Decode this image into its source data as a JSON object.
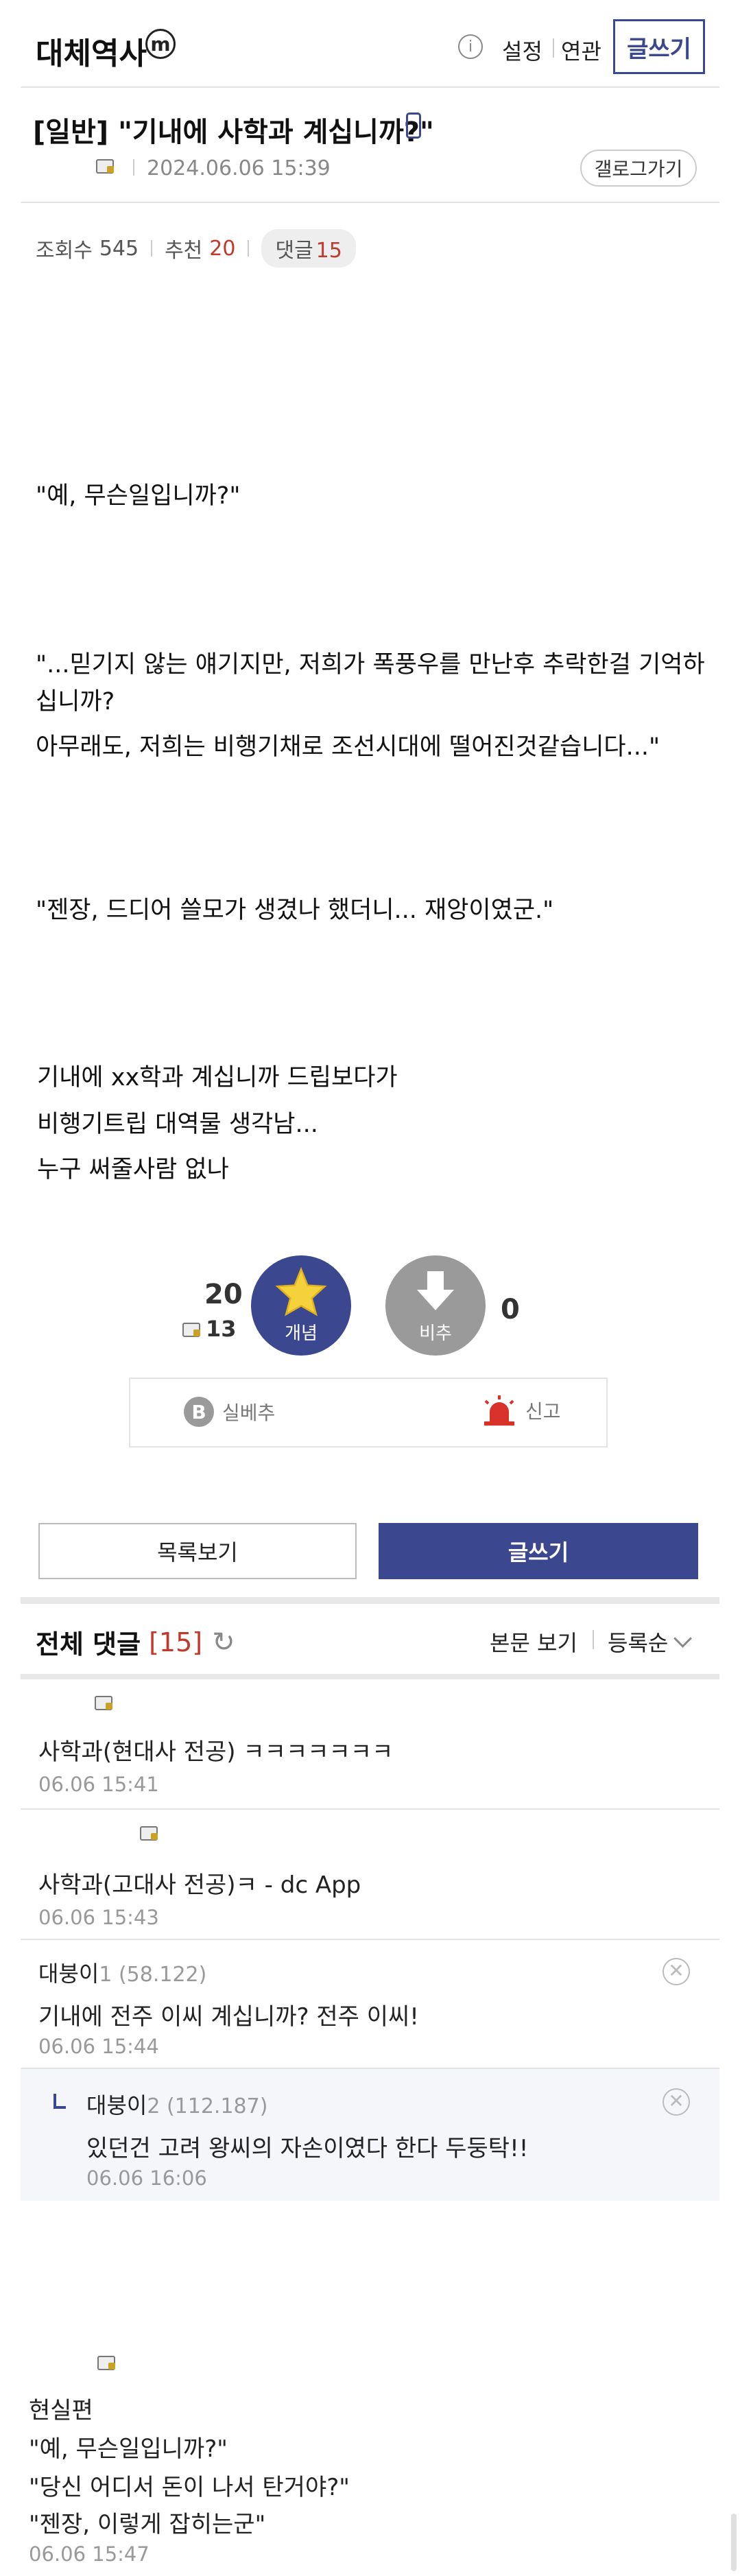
{
  "header": {
    "gallery_name": "대체역사",
    "m_badge": "m",
    "settings": "설정",
    "related": "연관",
    "write": "글쓰기"
  },
  "post": {
    "title": "[일반] \"기내에 사학과 계십니까?\"",
    "date": "2024.06.06 15:39",
    "gallog": "갤로그가기",
    "views_label": "조회수",
    "views": "545",
    "recommend_label": "추천",
    "recommend": "20",
    "comments_label": "댓글",
    "comments": "15"
  },
  "body": {
    "p1": "\"예, 무슨일입니까?\"",
    "p2a": "\"...믿기지 않는 얘기지만, 저희가 폭풍우를 만난후 추락한걸 기억하",
    "p2b": "십니까?",
    "p2c": "아무래도, 저희는 비행기채로 조선시대에 떨어진것같습니다...\"",
    "p3": "\"젠장, 드디어 쓸모가 생겼나 했더니... 재앙이였군.\"",
    "p4a": "기내에 xx학과 계십니까 드립보다가",
    "p4b": "비행기트립 대역물 생각남...",
    "p4c": "누구 써줄사람 없나"
  },
  "votes": {
    "up_count": "20",
    "fixed_count": "13",
    "up_label": "개념",
    "down_label": "비추",
    "down_count": "0",
    "best_label": "실베추",
    "report_label": "신고"
  },
  "actions": {
    "list": "목록보기",
    "write": "글쓰기"
  },
  "comments": {
    "header": "전체 댓글",
    "count": "[15]",
    "view_body": "본문 보기",
    "sort": "등록순",
    "items": [
      {
        "name": "",
        "text": "사학과(현대사 전공) ㅋㅋㅋㅋㅋㅋㅋ",
        "time": "06.06 15:41"
      },
      {
        "name": "",
        "text": "사학과(고대사 전공)ㅋ - dc App",
        "time": "06.06 15:43"
      },
      {
        "name": "대붕이",
        "ip": "1 (58.122)",
        "text": "기내에 전주 이씨 계십니까? 전주 이씨!",
        "time": "06.06 15:44"
      },
      {
        "name": "대붕이",
        "ip": "2 (112.187)",
        "text": "있던건 고려 왕씨의 자손이였다 한다 두둥탁!!",
        "time": "06.06 16:06"
      }
    ]
  },
  "bottom_comment": {
    "l1": "현실편",
    "l2": "\"예, 무슨일입니까?\"",
    "l3": "\"당신 어디서 돈이 나서 탄거야?\"",
    "l4": "\"젠장, 이렇게 잡히는군\"",
    "time": "06.06 15:47"
  },
  "colors": {
    "accent": "#3b4890",
    "recommend": "#c0392b",
    "report": "#d9322b"
  }
}
